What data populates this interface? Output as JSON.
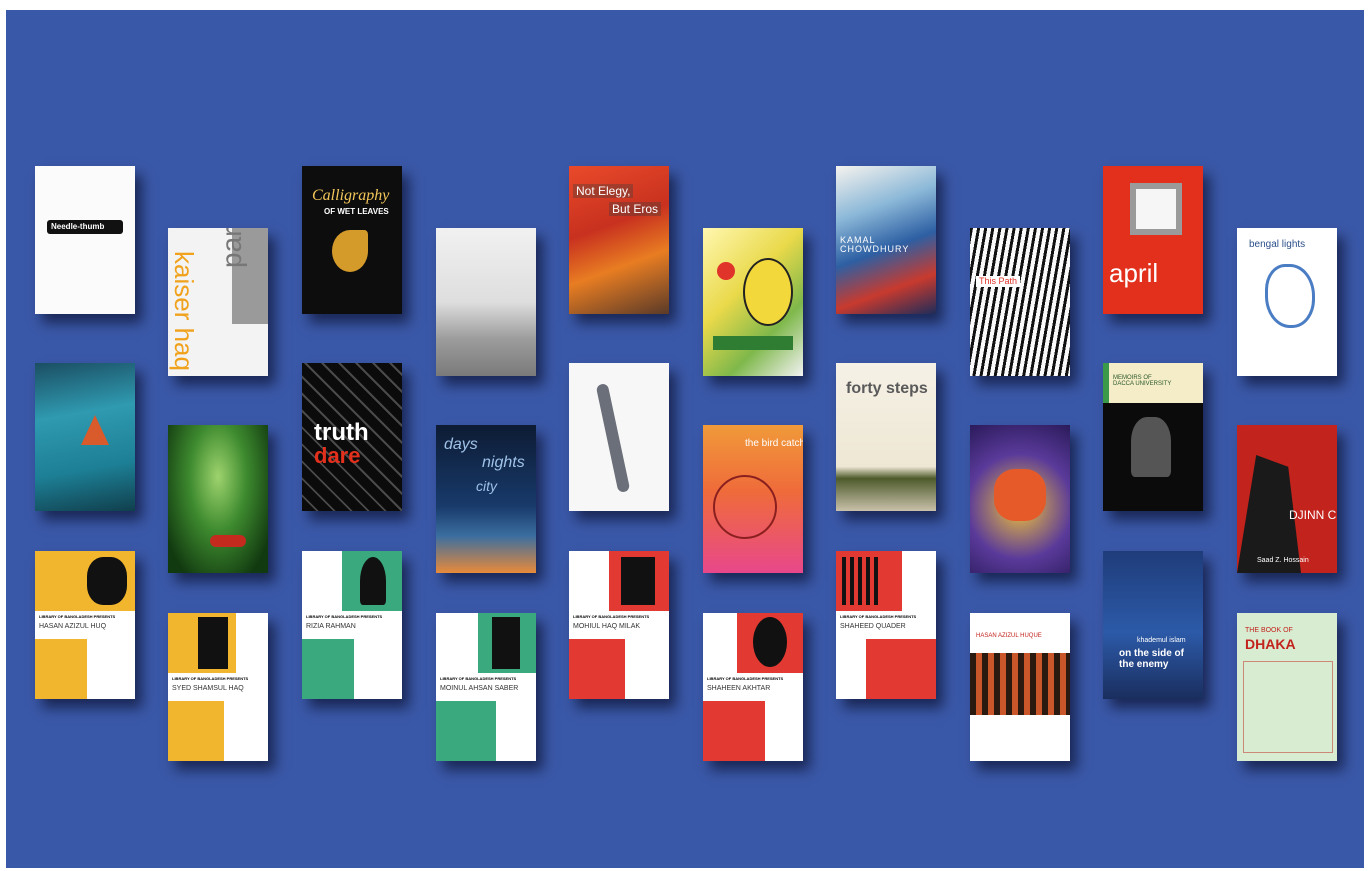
{
  "wall_color": "#3a58a8",
  "books": {
    "b1": {
      "title": "Needle-thumb"
    },
    "b2": {
      "title": "pariah",
      "author": "kaiser haq"
    },
    "b3": {
      "title_line1": "Calligraphy",
      "title_line2": "OF WET LEAVES"
    },
    "b5": {
      "title_line1": "Not Elegy,",
      "title_line2": "But Eros"
    },
    "b7": {
      "author": "KAMAL CHOWDHURY"
    },
    "b8": {
      "title": "This Path"
    },
    "b9": {
      "title": "april"
    },
    "b10": {
      "title": "bengal lights"
    },
    "b13": {
      "title": "truth",
      "title2": "dare"
    },
    "b14": {
      "word1": "days",
      "word2": "nights",
      "word3": "city"
    },
    "b16": {
      "title": "the bird catcher"
    },
    "b17": {
      "title": "forty steps"
    },
    "b19": {
      "title": "MEMOIRS OF DACCA UNIVERSITY"
    },
    "b20": {
      "title": "DJINN CITY",
      "author": "Saad Z. Hossain"
    },
    "lb_series": "LIBRARY OF BANGLADESH PRESENTS",
    "lb1": {
      "author": "HASAN AZIZUL HUQ"
    },
    "lb2": {
      "author": "SYED SHAMSUL HAQ"
    },
    "lb3": {
      "author": "RIZIA RAHMAN"
    },
    "lb4": {
      "author": "MOINUL AHSAN SABER"
    },
    "lb5": {
      "author": "MOHIUL HAQ MILAK"
    },
    "lb6": {
      "author": "SHAHEEN AKHTAR"
    },
    "lb7": {
      "author": "SHAHEED QUADER"
    },
    "b27": {
      "author": "HASAN AZIZUL HUQUE"
    },
    "b28": {
      "author": "khademul islam",
      "title": "on the side of the enemy"
    },
    "b29": {
      "title_line1": "THE BOOK OF",
      "title_line2": "DHAKA"
    }
  }
}
